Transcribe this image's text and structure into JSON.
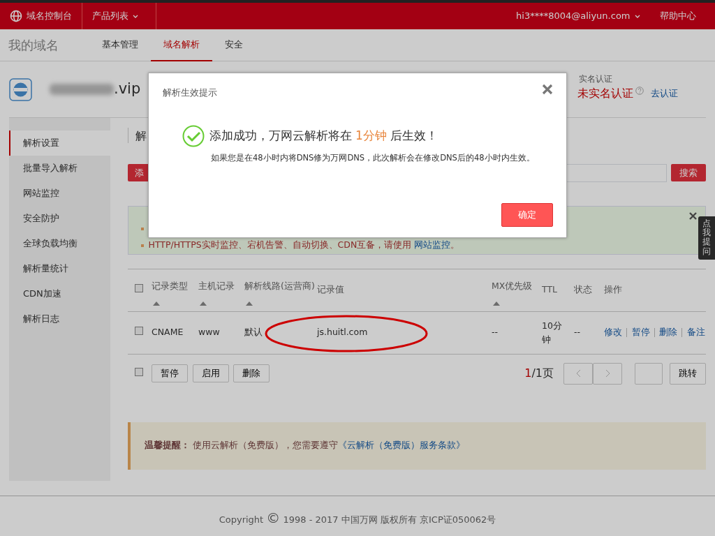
{
  "top_bar": {
    "title": "域名控制台",
    "menu": "产品列表",
    "account": "hi3****8004@aliyun.com",
    "help": "帮助中心"
  },
  "sub_nav": {
    "title": "我的域名",
    "tabs": [
      {
        "label": "基本管理",
        "selected": false
      },
      {
        "label": "域名解析",
        "selected": true
      },
      {
        "label": "安全",
        "selected": false
      }
    ]
  },
  "domain": {
    "suffix": ".vip"
  },
  "verification": {
    "label": "实名认证",
    "status": "未实名认证",
    "action": "去认证"
  },
  "sidebar": {
    "items": [
      {
        "label": "解析设置",
        "selected": true
      },
      {
        "label": "批量导入解析",
        "selected": false
      },
      {
        "label": "网站监控",
        "selected": false
      },
      {
        "label": "安全防护",
        "selected": false
      },
      {
        "label": "全球负载均衡",
        "selected": false
      },
      {
        "label": "解析量统计",
        "selected": false
      },
      {
        "label": "CDN加速",
        "selected": false
      },
      {
        "label": "解析日志",
        "selected": false
      }
    ]
  },
  "content": {
    "heading": "解",
    "add_button": "添",
    "search_button": "搜索"
  },
  "notice": {
    "lines": [
      {
        "kind": "covered"
      },
      {
        "kind": "text",
        "text": "HTTP/HTTPS实时监控、宕机告警、自动切换、CDN互备，请使用",
        "link": "网站监控",
        "end": "。"
      }
    ]
  },
  "table": {
    "header_checked": false,
    "columns": [
      {
        "label": "记录类型",
        "sortable": true
      },
      {
        "label": "主机记录",
        "sortable": true
      },
      {
        "label": "解析线路(运营商)",
        "sortable": true
      },
      {
        "label": "记录值",
        "sortable": false
      },
      {
        "label": "MX优先级",
        "sortable": true
      },
      {
        "label": "TTL",
        "sortable": false
      },
      {
        "label": "状态",
        "sortable": false
      },
      {
        "label": "操作",
        "sortable": false
      }
    ],
    "rows": [
      {
        "checked": false,
        "cells": [
          "CNAME",
          "www",
          "默认",
          "js.huitl.com",
          "--",
          "10分钟",
          "--"
        ],
        "actions": [
          "修改",
          "暂停",
          "删除",
          "备注"
        ]
      }
    ]
  },
  "batch": {
    "checked": false,
    "buttons": [
      "暂停",
      "启用",
      "删除"
    ],
    "page_current": "1",
    "page_total": "/1页",
    "jump": "跳转"
  },
  "tip": {
    "label": "温馨提醒：",
    "text": "使用云解析（免费版），您需要遵守",
    "link": "《云解析（免费版）服务条款》"
  },
  "footer": {
    "prefix": "Copyright",
    "symbol": "©",
    "text": "1998 - 2017 中国万网 版权所有 京ICP证050062号"
  },
  "help_tab": "点我提问",
  "modal": {
    "title": "解析生效提示",
    "message": "添加成功，万网云解析将在",
    "highlight": "1分钟",
    "message_end": "后生效！",
    "detail": "如果您是在48小时内将DNS修为万网DNS，此次解析会在修改DNS后的48小时内生效。",
    "ok": "确定"
  }
}
